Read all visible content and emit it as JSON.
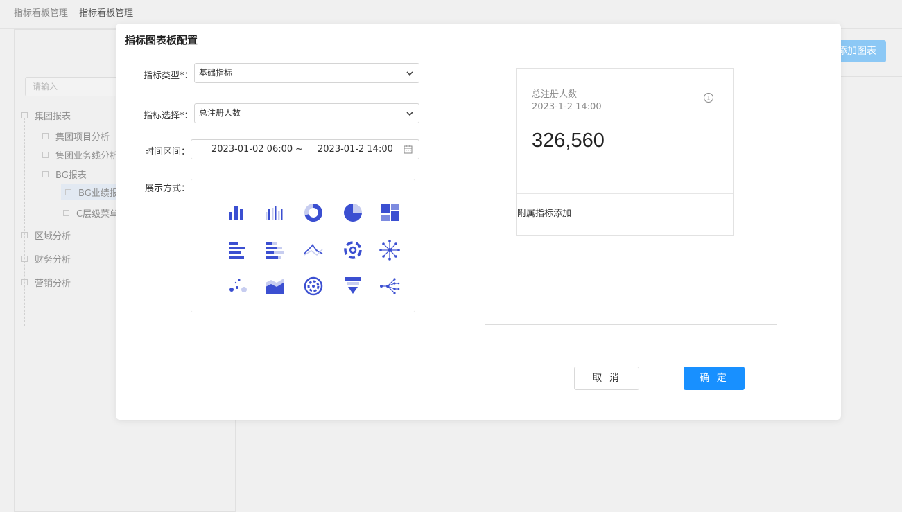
{
  "breadcrumb": [
    "指标看板管理",
    "指标看板管理"
  ],
  "background": {
    "add_chart_button": "添加图表",
    "search_placeholder": "请输入",
    "tree": [
      {
        "label": "集团报表"
      },
      {
        "label": "集团项目分析"
      },
      {
        "label": "集团业务线分析"
      },
      {
        "label": "BG报表"
      },
      {
        "label": "BG业绩报"
      },
      {
        "label": "C层级菜单"
      },
      {
        "label": "区域分析"
      },
      {
        "label": "财务分析"
      },
      {
        "label": "营销分析"
      }
    ]
  },
  "modal": {
    "title": "指标图表板配置",
    "form": {
      "metric_type_label": "指标类型*：",
      "metric_type_value": "基础指标",
      "metric_select_label": "指标选择*：",
      "metric_select_value": "总注册人数",
      "time_range_label": "时间区间：",
      "time_from": "2023-01-02   06:00",
      "time_sep": "~",
      "time_to": "2023-01-2  14:00",
      "display_label": "展示方式："
    },
    "chart_types": [
      "bar-chart-icon",
      "grouped-bar-chart-icon",
      "donut-chart-icon",
      "pie-chart-icon",
      "treemap-chart-icon",
      "horizontal-bar-chart-icon",
      "stacked-horizontal-bar-chart-icon",
      "line-chart-icon",
      "radial-chart-icon",
      "sunburst-chart-icon",
      "scatter-chart-icon",
      "area-chart-icon",
      "ring-gauge-chart-icon",
      "funnel-chart-icon",
      "tree-chart-icon"
    ],
    "preview": {
      "title": "总注册人数",
      "time": "2023-1-2 14:00",
      "value": "326,560",
      "sub_metric_label": "附属指标添加"
    },
    "cancel_label": "取 消",
    "ok_label": "确 定"
  },
  "colors": {
    "accent": "#1890ff",
    "chart_icon": "#3b4fd1",
    "chart_icon_light": "#c7cdf0"
  }
}
